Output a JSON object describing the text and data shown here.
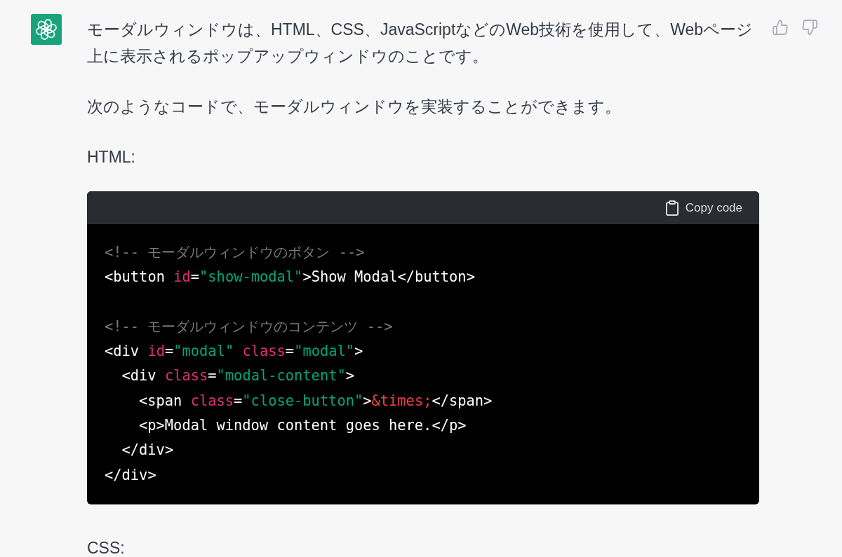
{
  "message": {
    "blocks": [
      {
        "kind": "paragraph",
        "text": "モーダルウィンドウは、HTML、CSS、JavaScriptなどのWeb技術を使用して、Webページ上に表示されるポップアップウィンドウのことです。"
      },
      {
        "kind": "paragraph",
        "text": "次のようなコードで、モーダルウィンドウを実装することができます。"
      },
      {
        "kind": "label",
        "text": "HTML:"
      },
      {
        "kind": "code",
        "copy_label": "Copy code",
        "groups": [
          [
            {
              "tokens": [
                {
                  "kind": "comment",
                  "text": "<!-- モーダルウィンドウのボタン -->"
                }
              ]
            },
            {
              "tokens": [
                {
                  "kind": "tag",
                  "text": "<button "
                },
                {
                  "kind": "attr",
                  "text": "id"
                },
                {
                  "kind": "tag",
                  "text": "="
                },
                {
                  "kind": "string",
                  "text": "\"show-modal\""
                },
                {
                  "kind": "tag",
                  "text": ">Show Modal</button>"
                }
              ]
            }
          ],
          [
            {
              "tokens": [
                {
                  "kind": "comment",
                  "text": "<!-- モーダルウィンドウのコンテンツ -->"
                }
              ]
            },
            {
              "tokens": [
                {
                  "kind": "tag",
                  "text": "<div "
                },
                {
                  "kind": "attr",
                  "text": "id"
                },
                {
                  "kind": "tag",
                  "text": "="
                },
                {
                  "kind": "string",
                  "text": "\"modal\" "
                },
                {
                  "kind": "attr",
                  "text": "class"
                },
                {
                  "kind": "tag",
                  "text": "="
                },
                {
                  "kind": "string",
                  "text": "\"modal\""
                },
                {
                  "kind": "tag",
                  "text": ">"
                }
              ],
              "children": [
                {
                  "tokens": [
                    {
                      "kind": "tag",
                      "text": "<div "
                    },
                    {
                      "kind": "attr",
                      "text": "class"
                    },
                    {
                      "kind": "tag",
                      "text": "="
                    },
                    {
                      "kind": "string",
                      "text": "\"modal-content\""
                    },
                    {
                      "kind": "tag",
                      "text": ">"
                    }
                  ],
                  "children": [
                    {
                      "tokens": [
                        {
                          "kind": "tag",
                          "text": "<span "
                        },
                        {
                          "kind": "attr",
                          "text": "class"
                        },
                        {
                          "kind": "tag",
                          "text": "="
                        },
                        {
                          "kind": "string",
                          "text": "\"close-button\""
                        },
                        {
                          "kind": "tag",
                          "text": ">"
                        },
                        {
                          "kind": "entity",
                          "text": "&times;"
                        },
                        {
                          "kind": "tag",
                          "text": "</span>"
                        }
                      ]
                    },
                    {
                      "tokens": [
                        {
                          "kind": "tag",
                          "text": "<p>Modal window content goes here.</p>"
                        }
                      ]
                    }
                  ]
                },
                {
                  "tokens": [
                    {
                      "kind": "tag",
                      "text": "</div>"
                    }
                  ]
                }
              ]
            },
            {
              "tokens": [
                {
                  "kind": "tag",
                  "text": "</div>"
                }
              ]
            }
          ]
        ]
      },
      {
        "kind": "label",
        "text": "CSS:"
      }
    ]
  }
}
